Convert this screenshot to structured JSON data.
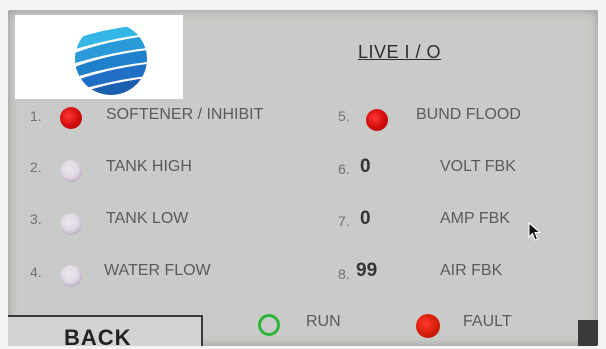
{
  "screen_title": "LIVE I / O",
  "left_items": [
    {
      "num": "1.",
      "label": "SOFTENER / INHIBIT",
      "state": "on"
    },
    {
      "num": "2.",
      "label": "TANK HIGH",
      "state": "off"
    },
    {
      "num": "3.",
      "label": "TANK LOW",
      "state": "off"
    },
    {
      "num": "4.",
      "label": "WATER FLOW",
      "state": "off"
    }
  ],
  "right_items": [
    {
      "num": "5.",
      "label": "BUND FLOOD",
      "state": "on"
    },
    {
      "num": "6.",
      "value": "0",
      "label": "VOLT FBK"
    },
    {
      "num": "7.",
      "value": "0",
      "label": "AMP FBK"
    },
    {
      "num": "8.",
      "value": "99",
      "label": "AIR FBK"
    }
  ],
  "footer": {
    "back_label": "BACK",
    "run_label": "RUN",
    "fault_label": "FAULT"
  },
  "colors": {
    "active_led": "#d10c0c",
    "inactive_led": "#dcd6e0",
    "run_ring": "#2eb33a",
    "logo_blue": "#1f6fc4",
    "logo_cyan": "#34b6e6"
  }
}
